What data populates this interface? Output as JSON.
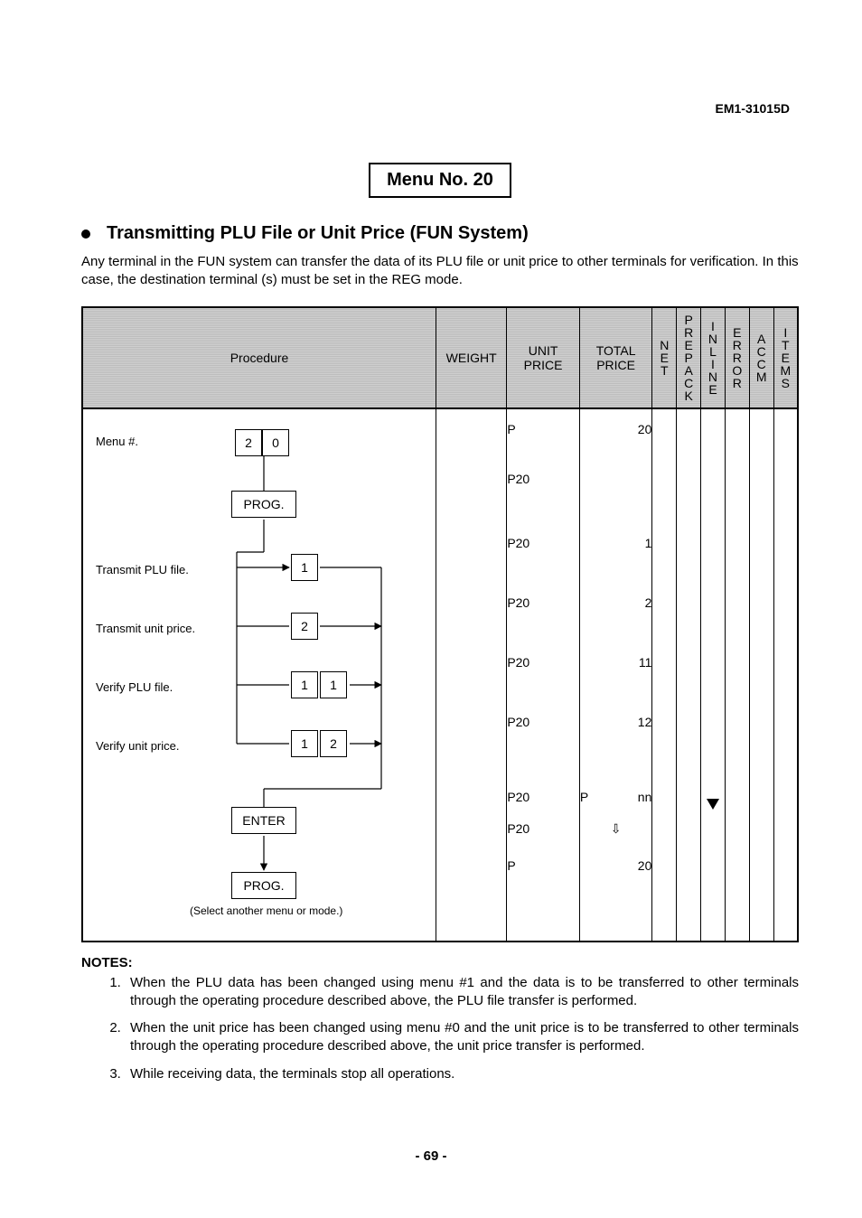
{
  "doc_id": "EM1-31015D",
  "menu_box": "Menu No. 20",
  "section_title": "Transmitting PLU File or Unit Price (FUN System)",
  "intro": "Any terminal in the FUN system can transfer the data of its PLU file or unit price to other terminals for verification.  In this case, the destination terminal (s) must be set in the REG mode.",
  "headers": {
    "procedure": "Procedure",
    "weight": "WEIGHT",
    "unit_price": "UNIT PRICE",
    "total_price": "TOTAL PRICE",
    "net": "NET",
    "prepack": "PREPACK",
    "inline": "INLINE",
    "error": "ERROR",
    "accm": "ACCM",
    "items": "ITEMS"
  },
  "proc": {
    "menu_num": "Menu #.",
    "key_2": "2",
    "key_0": "0",
    "prog": "PROG.",
    "transmit_plu": "Transmit PLU file.",
    "key_1": "1",
    "transmit_unit": "Transmit unit price.",
    "verify_plu": "Verify PLU file.",
    "verify_unit": "Verify unit price.",
    "enter": "ENTER",
    "select_note": "(Select another menu or mode.)"
  },
  "unit_price_col": [
    "P",
    "P20",
    "P20",
    "P20",
    "P20",
    "P20",
    "P20",
    "P20",
    "P"
  ],
  "total_price_col": {
    "r1": "20",
    "r3": "1",
    "r4": "2",
    "r5": "11",
    "r6": "12",
    "r7a": "P",
    "r7b": "nn",
    "r9": "20"
  },
  "inline_marker": "▼",
  "notes_heading": "NOTES:",
  "notes": {
    "n1": "When the PLU data has been changed using menu #1 and the data is to be transferred to other terminals through the operating procedure described above, the PLU file transfer is performed.",
    "n2": "When the unit price has been changed using menu #0 and the unit price is to be transferred to other terminals through the operating procedure described above, the unit price transfer is performed.",
    "n3": "While receiving data, the terminals stop all operations."
  },
  "page_number": "- 69 -"
}
